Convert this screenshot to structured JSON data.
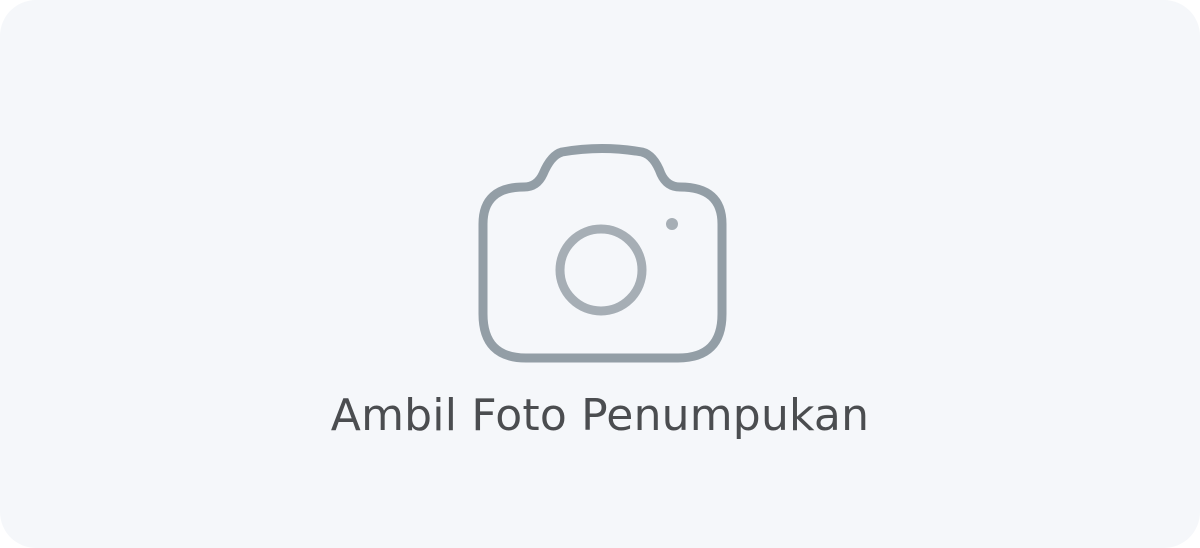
{
  "capture_button": {
    "label": "Ambil Foto Penumpukan",
    "icon": "camera-icon"
  },
  "colors": {
    "card_background": "#f5f7fa",
    "icon_body": "#939ea6",
    "icon_lens": "#a6aeb5",
    "label_text": "#4b4d50"
  }
}
